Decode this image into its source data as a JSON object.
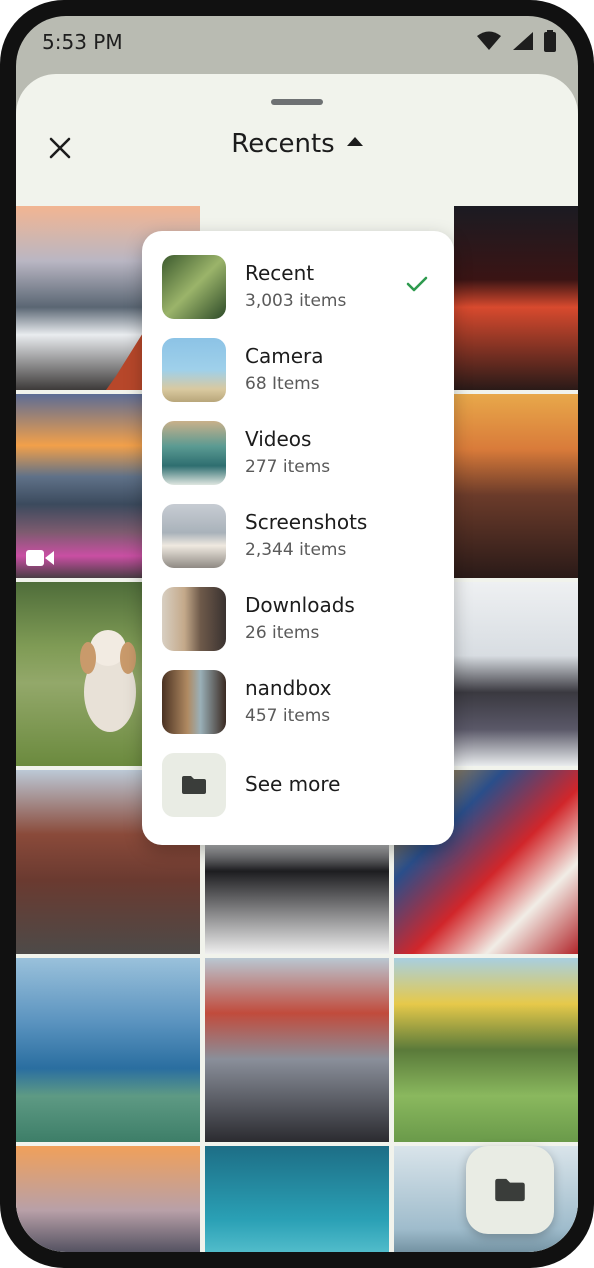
{
  "status_bar": {
    "time": "5:53 PM",
    "icons": [
      "wifi-icon",
      "signal-icon",
      "battery-icon"
    ]
  },
  "header": {
    "title": "Recents",
    "close_icon": "close-icon",
    "dropdown_icon": "caret-up-icon"
  },
  "album_menu": {
    "items": [
      {
        "name": "Recent",
        "count": "3,003 items",
        "selected": true
      },
      {
        "name": "Camera",
        "count": "68 Items",
        "selected": false
      },
      {
        "name": "Videos",
        "count": "277 items",
        "selected": false
      },
      {
        "name": "Screenshots",
        "count": "2,344 items",
        "selected": false
      },
      {
        "name": "Downloads",
        "count": "26 items",
        "selected": false
      },
      {
        "name": "nandbox",
        "count": "457 items",
        "selected": false
      }
    ],
    "see_more": "See more"
  },
  "colors": {
    "accent_check": "#2e9a4e",
    "sheet_bg": "#f1f3ec"
  },
  "fab": {
    "icon": "folder-icon"
  }
}
